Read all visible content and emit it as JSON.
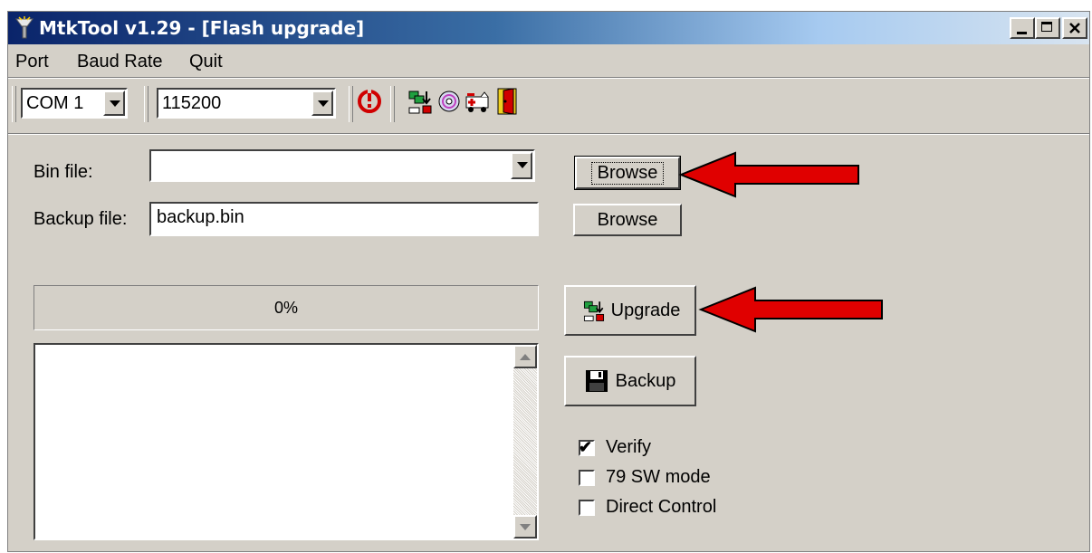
{
  "window": {
    "title": "MtkTool v1.29 - [Flash upgrade]",
    "controls": [
      "minimize",
      "maximize",
      "close"
    ]
  },
  "menu": [
    "Port",
    "Baud Rate",
    "Quit"
  ],
  "toolbar": {
    "port_value": "COM 1",
    "baud_value": "115200",
    "icons": [
      "reset-icon",
      "upgrade-icon",
      "disc-icon",
      "ambulance-icon",
      "exit-door-icon"
    ]
  },
  "form": {
    "bin_label": "Bin file:",
    "bin_value": "",
    "backup_label": "Backup file:",
    "backup_value": "backup.bin",
    "browse_label": "Browse",
    "browse2_label": "Browse"
  },
  "progress": {
    "text": "0%",
    "value": 0
  },
  "actions": {
    "upgrade_label": "Upgrade",
    "backup_label": "Backup"
  },
  "options": [
    {
      "label": "Verify",
      "checked": true
    },
    {
      "label": "79 SW mode",
      "checked": false
    },
    {
      "label": "Direct Control",
      "checked": false
    }
  ],
  "colors": {
    "annotation_arrow": "#e00000",
    "titlebar_start": "#0a246a",
    "face": "#d4d0c8"
  }
}
